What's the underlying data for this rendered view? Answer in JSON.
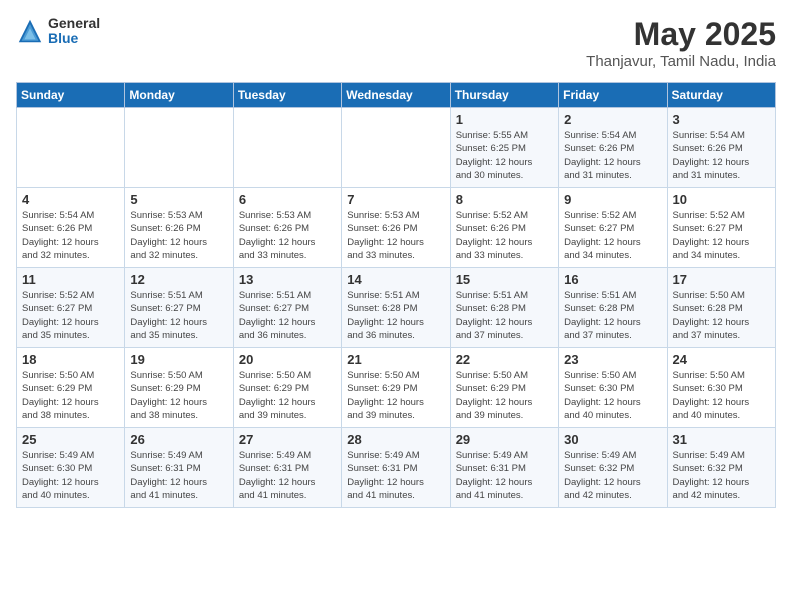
{
  "logo": {
    "general": "General",
    "blue": "Blue"
  },
  "title": {
    "month_year": "May 2025",
    "location": "Thanjavur, Tamil Nadu, India"
  },
  "headers": [
    "Sunday",
    "Monday",
    "Tuesday",
    "Wednesday",
    "Thursday",
    "Friday",
    "Saturday"
  ],
  "weeks": [
    [
      {
        "day": "",
        "info": ""
      },
      {
        "day": "",
        "info": ""
      },
      {
        "day": "",
        "info": ""
      },
      {
        "day": "",
        "info": ""
      },
      {
        "day": "1",
        "info": "Sunrise: 5:55 AM\nSunset: 6:25 PM\nDaylight: 12 hours\nand 30 minutes."
      },
      {
        "day": "2",
        "info": "Sunrise: 5:54 AM\nSunset: 6:26 PM\nDaylight: 12 hours\nand 31 minutes."
      },
      {
        "day": "3",
        "info": "Sunrise: 5:54 AM\nSunset: 6:26 PM\nDaylight: 12 hours\nand 31 minutes."
      }
    ],
    [
      {
        "day": "4",
        "info": "Sunrise: 5:54 AM\nSunset: 6:26 PM\nDaylight: 12 hours\nand 32 minutes."
      },
      {
        "day": "5",
        "info": "Sunrise: 5:53 AM\nSunset: 6:26 PM\nDaylight: 12 hours\nand 32 minutes."
      },
      {
        "day": "6",
        "info": "Sunrise: 5:53 AM\nSunset: 6:26 PM\nDaylight: 12 hours\nand 33 minutes."
      },
      {
        "day": "7",
        "info": "Sunrise: 5:53 AM\nSunset: 6:26 PM\nDaylight: 12 hours\nand 33 minutes."
      },
      {
        "day": "8",
        "info": "Sunrise: 5:52 AM\nSunset: 6:26 PM\nDaylight: 12 hours\nand 33 minutes."
      },
      {
        "day": "9",
        "info": "Sunrise: 5:52 AM\nSunset: 6:27 PM\nDaylight: 12 hours\nand 34 minutes."
      },
      {
        "day": "10",
        "info": "Sunrise: 5:52 AM\nSunset: 6:27 PM\nDaylight: 12 hours\nand 34 minutes."
      }
    ],
    [
      {
        "day": "11",
        "info": "Sunrise: 5:52 AM\nSunset: 6:27 PM\nDaylight: 12 hours\nand 35 minutes."
      },
      {
        "day": "12",
        "info": "Sunrise: 5:51 AM\nSunset: 6:27 PM\nDaylight: 12 hours\nand 35 minutes."
      },
      {
        "day": "13",
        "info": "Sunrise: 5:51 AM\nSunset: 6:27 PM\nDaylight: 12 hours\nand 36 minutes."
      },
      {
        "day": "14",
        "info": "Sunrise: 5:51 AM\nSunset: 6:28 PM\nDaylight: 12 hours\nand 36 minutes."
      },
      {
        "day": "15",
        "info": "Sunrise: 5:51 AM\nSunset: 6:28 PM\nDaylight: 12 hours\nand 37 minutes."
      },
      {
        "day": "16",
        "info": "Sunrise: 5:51 AM\nSunset: 6:28 PM\nDaylight: 12 hours\nand 37 minutes."
      },
      {
        "day": "17",
        "info": "Sunrise: 5:50 AM\nSunset: 6:28 PM\nDaylight: 12 hours\nand 37 minutes."
      }
    ],
    [
      {
        "day": "18",
        "info": "Sunrise: 5:50 AM\nSunset: 6:29 PM\nDaylight: 12 hours\nand 38 minutes."
      },
      {
        "day": "19",
        "info": "Sunrise: 5:50 AM\nSunset: 6:29 PM\nDaylight: 12 hours\nand 38 minutes."
      },
      {
        "day": "20",
        "info": "Sunrise: 5:50 AM\nSunset: 6:29 PM\nDaylight: 12 hours\nand 39 minutes."
      },
      {
        "day": "21",
        "info": "Sunrise: 5:50 AM\nSunset: 6:29 PM\nDaylight: 12 hours\nand 39 minutes."
      },
      {
        "day": "22",
        "info": "Sunrise: 5:50 AM\nSunset: 6:29 PM\nDaylight: 12 hours\nand 39 minutes."
      },
      {
        "day": "23",
        "info": "Sunrise: 5:50 AM\nSunset: 6:30 PM\nDaylight: 12 hours\nand 40 minutes."
      },
      {
        "day": "24",
        "info": "Sunrise: 5:50 AM\nSunset: 6:30 PM\nDaylight: 12 hours\nand 40 minutes."
      }
    ],
    [
      {
        "day": "25",
        "info": "Sunrise: 5:49 AM\nSunset: 6:30 PM\nDaylight: 12 hours\nand 40 minutes."
      },
      {
        "day": "26",
        "info": "Sunrise: 5:49 AM\nSunset: 6:31 PM\nDaylight: 12 hours\nand 41 minutes."
      },
      {
        "day": "27",
        "info": "Sunrise: 5:49 AM\nSunset: 6:31 PM\nDaylight: 12 hours\nand 41 minutes."
      },
      {
        "day": "28",
        "info": "Sunrise: 5:49 AM\nSunset: 6:31 PM\nDaylight: 12 hours\nand 41 minutes."
      },
      {
        "day": "29",
        "info": "Sunrise: 5:49 AM\nSunset: 6:31 PM\nDaylight: 12 hours\nand 41 minutes."
      },
      {
        "day": "30",
        "info": "Sunrise: 5:49 AM\nSunset: 6:32 PM\nDaylight: 12 hours\nand 42 minutes."
      },
      {
        "day": "31",
        "info": "Sunrise: 5:49 AM\nSunset: 6:32 PM\nDaylight: 12 hours\nand 42 minutes."
      }
    ]
  ]
}
